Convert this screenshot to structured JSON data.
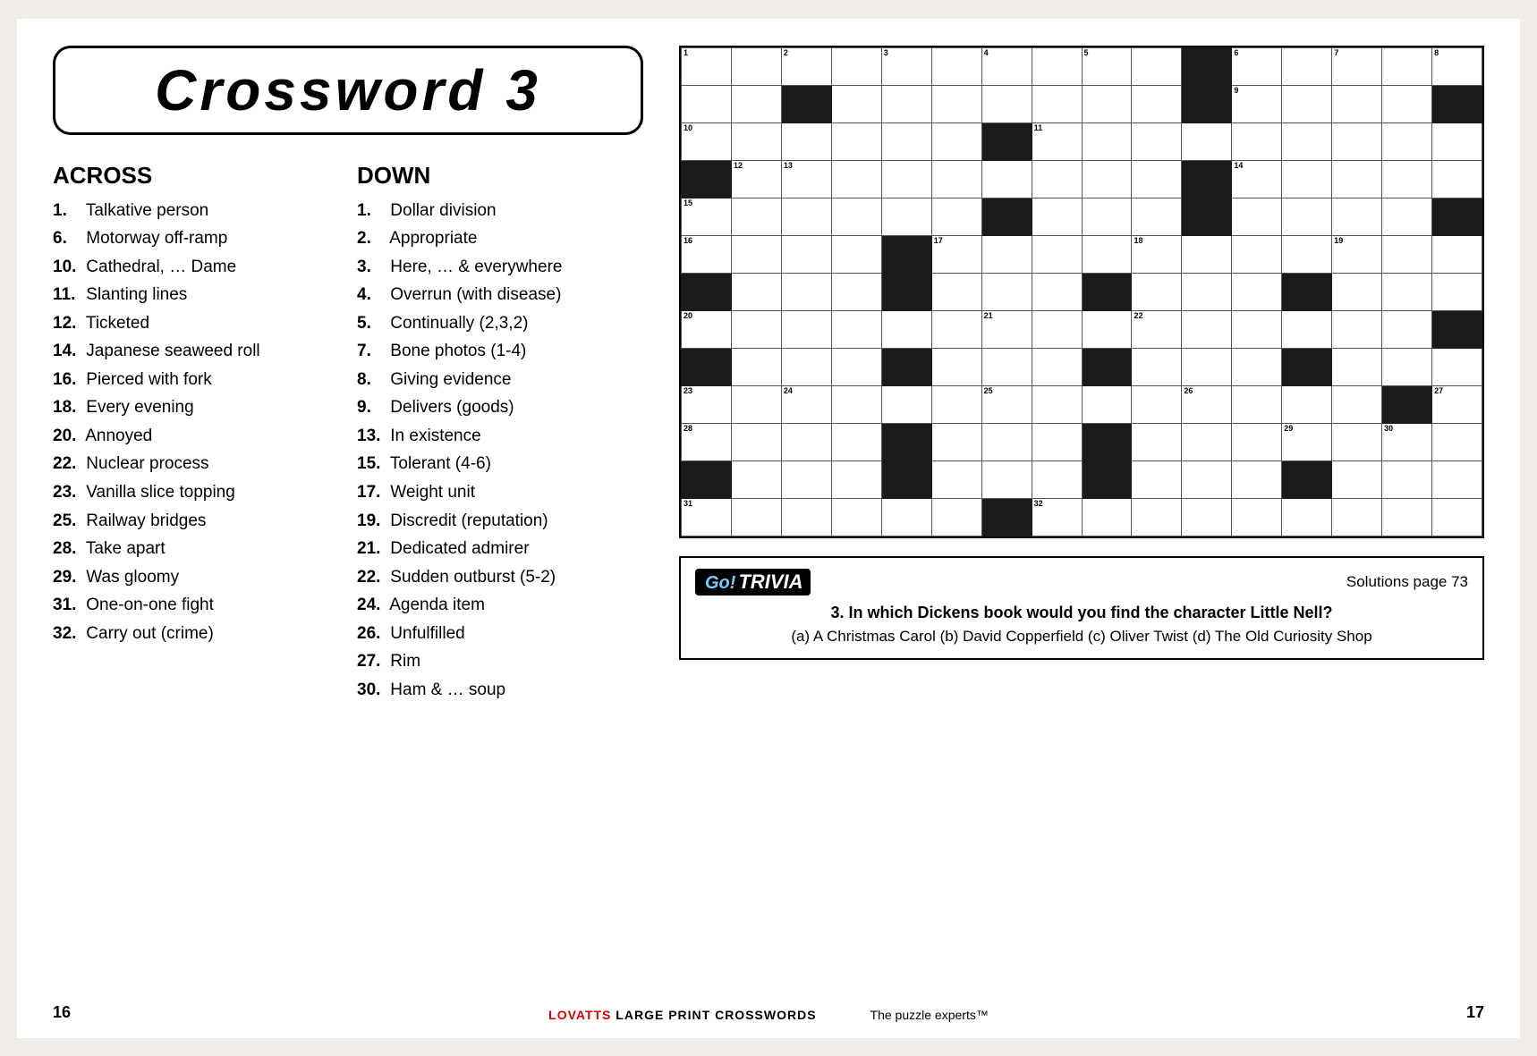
{
  "title": "Crossword   3",
  "across": {
    "heading": "ACROSS",
    "clues": [
      {
        "num": "1.",
        "text": "Talkative person"
      },
      {
        "num": "6.",
        "text": "Motorway off-ramp"
      },
      {
        "num": "10.",
        "text": "Cathedral, … Dame"
      },
      {
        "num": "11.",
        "text": "Slanting lines"
      },
      {
        "num": "12.",
        "text": "Ticketed"
      },
      {
        "num": "14.",
        "text": "Japanese seaweed roll"
      },
      {
        "num": "16.",
        "text": "Pierced with fork"
      },
      {
        "num": "18.",
        "text": "Every evening"
      },
      {
        "num": "20.",
        "text": "Annoyed"
      },
      {
        "num": "22.",
        "text": "Nuclear process"
      },
      {
        "num": "23.",
        "text": "Vanilla slice topping"
      },
      {
        "num": "25.",
        "text": "Railway bridges"
      },
      {
        "num": "28.",
        "text": "Take apart"
      },
      {
        "num": "29.",
        "text": "Was gloomy"
      },
      {
        "num": "31.",
        "text": "One-on-one fight"
      },
      {
        "num": "32.",
        "text": "Carry out (crime)"
      }
    ]
  },
  "down": {
    "heading": "DOWN",
    "clues": [
      {
        "num": "1.",
        "text": "Dollar division"
      },
      {
        "num": "2.",
        "text": "Appropriate"
      },
      {
        "num": "3.",
        "text": "Here, … & everywhere"
      },
      {
        "num": "4.",
        "text": "Overrun (with disease)"
      },
      {
        "num": "5.",
        "text": "Continually (2,3,2)"
      },
      {
        "num": "7.",
        "text": "Bone photos (1-4)"
      },
      {
        "num": "8.",
        "text": "Giving evidence"
      },
      {
        "num": "9.",
        "text": "Delivers (goods)"
      },
      {
        "num": "13.",
        "text": "In existence"
      },
      {
        "num": "15.",
        "text": "Tolerant (4-6)"
      },
      {
        "num": "17.",
        "text": "Weight unit"
      },
      {
        "num": "19.",
        "text": "Discredit (reputation)"
      },
      {
        "num": "21.",
        "text": "Dedicated admirer"
      },
      {
        "num": "22.",
        "text": "Sudden outburst (5-2)"
      },
      {
        "num": "24.",
        "text": "Agenda item"
      },
      {
        "num": "26.",
        "text": "Unfulfilled"
      },
      {
        "num": "27.",
        "text": "Rim"
      },
      {
        "num": "30.",
        "text": "Ham & … soup"
      }
    ]
  },
  "trivia": {
    "logo": "GoTRIVIA",
    "solutions": "Solutions page 73",
    "question": "3. In which Dickens book would you find the character Little Nell?",
    "answers": "(a) A Christmas Carol  (b) David Copperfield  (c) Oliver Twist  (d) The Old Curiosity Shop"
  },
  "footer": {
    "page_left": "16",
    "page_right": "17",
    "brand": "LOVATTS LARGE PRINT CROSSWORDS",
    "tagline": "The puzzle experts™"
  }
}
